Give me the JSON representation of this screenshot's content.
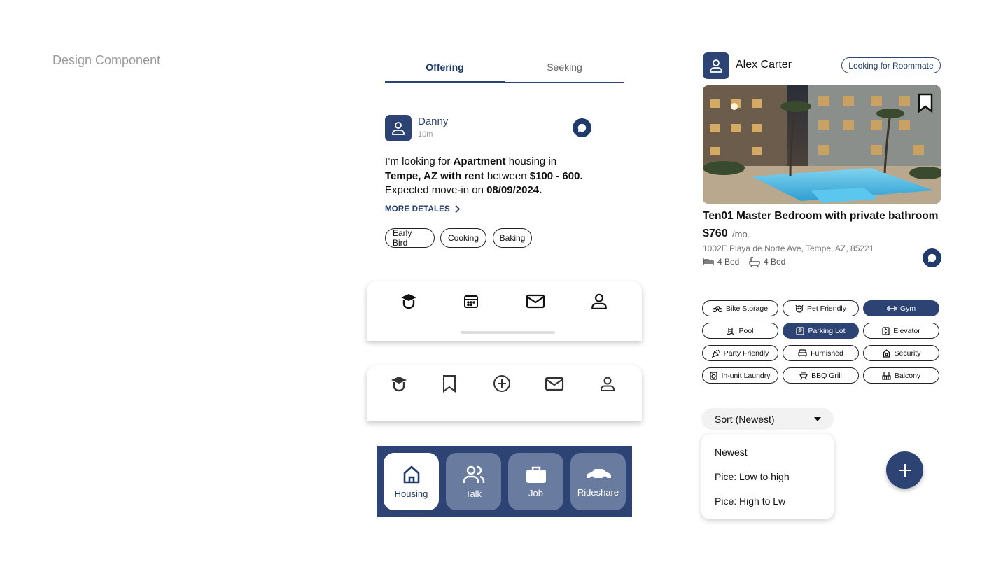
{
  "page": {
    "title": "Design Component"
  },
  "tabs": [
    {
      "label": "Offering",
      "active": true
    },
    {
      "label": "Seeking",
      "active": false
    }
  ],
  "post": {
    "name": "Danny",
    "time": "10m",
    "body": {
      "t1": "I’m looking for ",
      "b1": "Apartment",
      "t2": " housing in ",
      "b2": "Tempe, AZ with rent",
      "t3": " between ",
      "b3": "$100 - 600.",
      "t4": " Expected move-in on ",
      "b4": "08/09/2024."
    },
    "more_label": "MORE DETALES",
    "tags": [
      "Early Bird",
      "Cooking",
      "Baking"
    ]
  },
  "nav1": {
    "icons": [
      "graduation-cap-icon",
      "calendar-icon",
      "mail-icon",
      "profile-icon"
    ]
  },
  "nav2": {
    "icons": [
      "graduation-cap-icon",
      "bookmark-icon",
      "add-circle-icon",
      "mail-icon",
      "profile-icon"
    ]
  },
  "nav3": {
    "items": [
      {
        "label": "Housing",
        "icon": "home-icon",
        "active": true
      },
      {
        "label": "Talk",
        "icon": "users-icon",
        "active": false
      },
      {
        "label": "Job",
        "icon": "briefcase-icon",
        "active": false
      },
      {
        "label": "Rideshare",
        "icon": "car-icon",
        "active": false
      }
    ]
  },
  "listing": {
    "user_name": "Alex Carter",
    "badge": "Looking for Roommate",
    "title": "Ten01 Master Bedroom with private bathroom",
    "price": "$760",
    "price_unit": "/mo.",
    "address": "1002E Playa de Norte Ave, Tempe, AZ, 85221",
    "beds": "4 Bed",
    "baths": "4 Bed"
  },
  "amenities": [
    {
      "label": "Bike Storage",
      "icon": "bike-icon",
      "selected": false
    },
    {
      "label": "Pet Friendly",
      "icon": "pet-icon",
      "selected": false
    },
    {
      "label": "Gym",
      "icon": "dumbbell-icon",
      "selected": true
    },
    {
      "label": "Pool",
      "icon": "pool-icon",
      "selected": false
    },
    {
      "label": "Parking Lot",
      "icon": "parking-icon",
      "selected": true
    },
    {
      "label": "Elevator",
      "icon": "elevator-icon",
      "selected": false
    },
    {
      "label": "Party Friendly",
      "icon": "party-icon",
      "selected": false
    },
    {
      "label": "Furnished",
      "icon": "sofa-icon",
      "selected": false
    },
    {
      "label": "Security",
      "icon": "security-icon",
      "selected": false
    },
    {
      "label": "In-unit Laundry",
      "icon": "laundry-icon",
      "selected": false
    },
    {
      "label": "BBQ Grill",
      "icon": "grill-icon",
      "selected": false
    },
    {
      "label": "Balcony",
      "icon": "balcony-icon",
      "selected": false
    }
  ],
  "sort": {
    "label": "Sort (Newest)",
    "options": [
      "Newest",
      "Pice: Low to high",
      "Pice: High to Lw"
    ]
  },
  "colors": {
    "primary": "#2d4373",
    "tile_inactive": "#6a7ba0"
  }
}
